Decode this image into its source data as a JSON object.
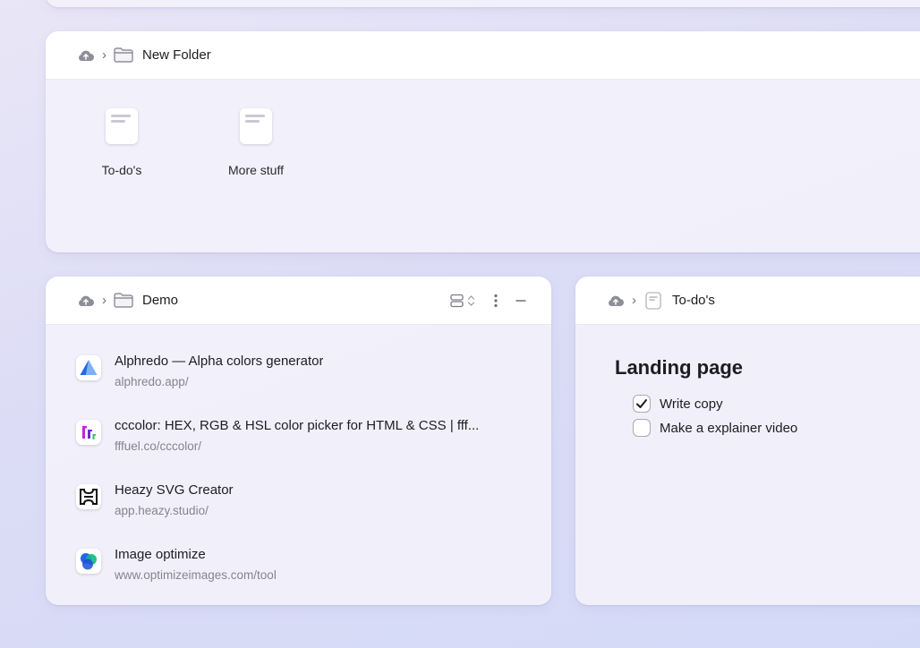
{
  "new_folder_panel": {
    "title": "New Folder",
    "files": [
      {
        "name": "To-do's"
      },
      {
        "name": "More stuff"
      }
    ]
  },
  "demo_panel": {
    "title": "Demo",
    "links": [
      {
        "title": "Alphredo — Alpha colors generator",
        "url": "alphredo.app/",
        "icon": "alphredo-logo"
      },
      {
        "title": "cccolor: HEX, RGB & HSL color picker for HTML & CSS | fff...",
        "url": "fffuel.co/cccolor/",
        "icon": "cccolor-logo"
      },
      {
        "title": "Heazy SVG Creator",
        "url": "app.heazy.studio/",
        "icon": "heazy-logo"
      },
      {
        "title": "Image optimize",
        "url": "www.optimizeimages.com/tool",
        "icon": "image-optimize-logo"
      }
    ]
  },
  "todo_panel": {
    "title": "To-do's",
    "heading": "Landing page",
    "items": [
      {
        "label": "Write copy",
        "checked": true
      },
      {
        "label": "Make a explainer video",
        "checked": false
      }
    ]
  },
  "icons": {
    "cloud": "cloud-icon",
    "chevron": "chevron-right-icon",
    "folder": "folder-icon",
    "document": "document-icon",
    "view_toggle": "view-toggle-icon",
    "more": "more-vertical-icon",
    "minimize": "minimize-icon"
  }
}
